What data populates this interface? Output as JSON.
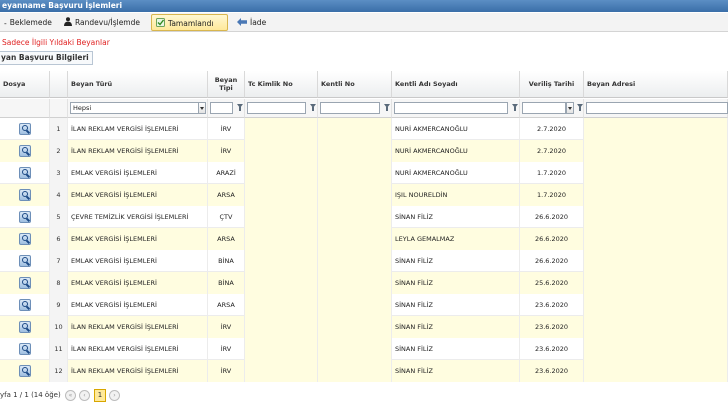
{
  "title": "eyanname Başvuru İşlemleri",
  "tabs": [
    {
      "label": "Beklemede",
      "icon": "dash-icon"
    },
    {
      "label": "Randevu/İşlemde",
      "icon": "user-icon"
    },
    {
      "label": "Tamamlandı",
      "icon": "check-icon"
    },
    {
      "label": "İade",
      "icon": "arrow-left-icon"
    }
  ],
  "note": "Sadece İlgili Yıldaki Beyanlar",
  "section_title": "yan Başvuru Bilgileri",
  "columns": {
    "dosya": "Dosya",
    "beyan_turu": "Beyan Türü",
    "beyan_tipi": "Beyan Tipi",
    "tc": "Tc Kimlik No",
    "kentli_no": "Kentli No",
    "kentli_adi": "Kentli Adı Soyadı",
    "verilis": "Veriliş Tarihi",
    "adres": "Beyan Adresi"
  },
  "filters": {
    "beyan_turu": "Hepsi"
  },
  "rows": [
    {
      "n": "1",
      "turu": "İLAN REKLAM VERGİSİ İŞLEMLERİ",
      "tipi": "İRV",
      "adi": "NURİ AKMERCANOĞLU",
      "tarih": "2.7.2020"
    },
    {
      "n": "2",
      "turu": "İLAN REKLAM VERGİSİ İŞLEMLERİ",
      "tipi": "İRV",
      "adi": "NURİ AKMERCANOĞLU",
      "tarih": "2.7.2020"
    },
    {
      "n": "3",
      "turu": "EMLAK VERGİSİ İŞLEMLERİ",
      "tipi": "ARAZİ",
      "adi": "NURİ AKMERCANOĞLU",
      "tarih": "1.7.2020"
    },
    {
      "n": "4",
      "turu": "EMLAK VERGİSİ İŞLEMLERİ",
      "tipi": "ARSA",
      "adi": "IŞIL NOURELDİN",
      "tarih": "1.7.2020"
    },
    {
      "n": "5",
      "turu": "ÇEVRE TEMİZLİK VERGİSİ İŞLEMLERİ",
      "tipi": "ÇTV",
      "adi": "SİNAN FİLİZ",
      "tarih": "26.6.2020"
    },
    {
      "n": "6",
      "turu": "EMLAK VERGİSİ İŞLEMLERİ",
      "tipi": "ARSA",
      "adi": "LEYLA GEMALMAZ",
      "tarih": "26.6.2020"
    },
    {
      "n": "7",
      "turu": "EMLAK VERGİSİ İŞLEMLERİ",
      "tipi": "BİNA",
      "adi": "SİNAN FİLİZ",
      "tarih": "26.6.2020"
    },
    {
      "n": "8",
      "turu": "EMLAK VERGİSİ İŞLEMLERİ",
      "tipi": "BİNA",
      "adi": "SİNAN FİLİZ",
      "tarih": "25.6.2020"
    },
    {
      "n": "9",
      "turu": "EMLAK VERGİSİ İŞLEMLERİ",
      "tipi": "ARSA",
      "adi": "SİNAN FİLİZ",
      "tarih": "23.6.2020"
    },
    {
      "n": "10",
      "turu": "İLAN REKLAM VERGİSİ İŞLEMLERİ",
      "tipi": "İRV",
      "adi": "SİNAN FİLİZ",
      "tarih": "23.6.2020"
    },
    {
      "n": "11",
      "turu": "İLAN REKLAM VERGİSİ İŞLEMLERİ",
      "tipi": "İRV",
      "adi": "SİNAN FİLİZ",
      "tarih": "23.6.2020"
    },
    {
      "n": "12",
      "turu": "İLAN REKLAM VERGİSİ İŞLEMLERİ",
      "tipi": "İRV",
      "adi": "SİNAN FİLİZ",
      "tarih": "23.6.2020"
    }
  ],
  "pager": {
    "info": "yfa 1 / 1 (14 öğe)",
    "current_page": "1"
  }
}
